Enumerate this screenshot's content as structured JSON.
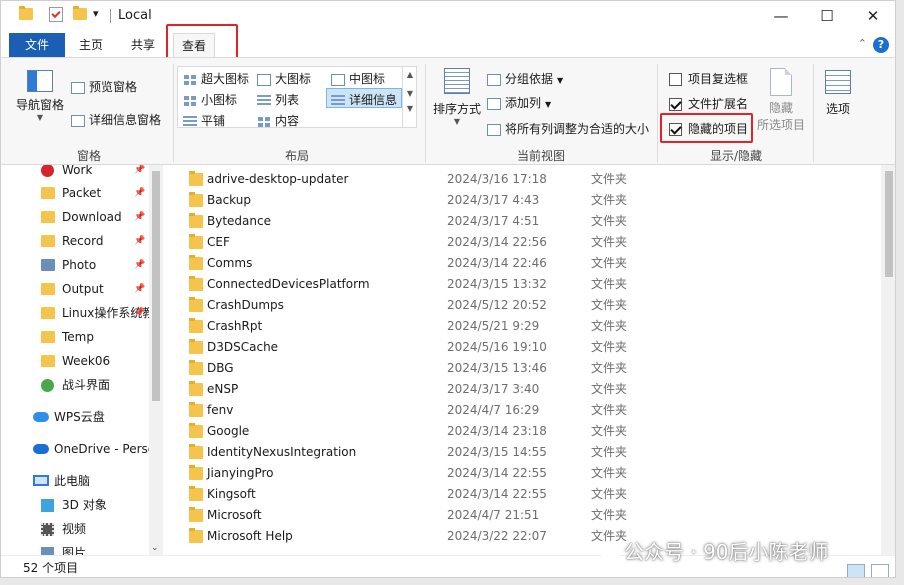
{
  "window": {
    "title": "Local"
  },
  "titlebar": {
    "dropdown_glyph": "▾",
    "minimize": "—",
    "maximize": "☐",
    "close": "✕"
  },
  "tabs": {
    "file": "文件",
    "home": "主页",
    "share": "共享",
    "view": "查看",
    "help": "?",
    "collapse": "⌃"
  },
  "ribbon": {
    "panes": {
      "label": "窗格",
      "nav_pane": "导航窗格",
      "preview": "预览窗格",
      "details": "详细信息窗格"
    },
    "layout": {
      "label": "布局",
      "xlarge": "超大图标",
      "large": "大图标",
      "medium": "中图标",
      "small": "小图标",
      "list": "列表",
      "detail": "详细信息",
      "tiles": "平铺",
      "content": "内容"
    },
    "current_view": {
      "label": "当前视图",
      "sort": "排序方式",
      "group": "分组依据",
      "add_column": "添加列",
      "fit_columns": "将所有列调整为合适的大小"
    },
    "show_hide": {
      "label": "显示/隐藏",
      "checkboxes": "项目复选框",
      "extensions": "文件扩展名",
      "hidden": "隐藏的项目",
      "hide_selected_line1": "隐藏",
      "hide_selected_line2": "所选项目"
    },
    "options": {
      "label": "选项"
    }
  },
  "nav": {
    "items": [
      {
        "label": "Work",
        "pinned": true
      },
      {
        "label": "Packet",
        "pinned": true
      },
      {
        "label": "Download",
        "pinned": true
      },
      {
        "label": "Record",
        "pinned": true
      },
      {
        "label": "Photo",
        "pinned": true
      },
      {
        "label": "Output",
        "pinned": true
      },
      {
        "label": "Linux操作系统教",
        "pinned": true
      },
      {
        "label": "Temp",
        "pinned": false
      },
      {
        "label": "Week06",
        "pinned": false
      },
      {
        "label": "战斗界面",
        "pinned": false
      },
      {
        "label": "WPS云盘",
        "pinned": false
      },
      {
        "label": "OneDrive - Perso",
        "pinned": false
      },
      {
        "label": "此电脑",
        "pinned": false
      },
      {
        "label": "3D 对象",
        "pinned": false
      },
      {
        "label": "视频",
        "pinned": false
      },
      {
        "label": "图片",
        "pinned": false
      }
    ]
  },
  "files": {
    "rows": [
      {
        "name": "adrive-desktop-updater",
        "date": "2024/3/16 17:18",
        "type": "文件夹"
      },
      {
        "name": "Backup",
        "date": "2024/3/17 4:43",
        "type": "文件夹"
      },
      {
        "name": "Bytedance",
        "date": "2024/3/17 4:51",
        "type": "文件夹"
      },
      {
        "name": "CEF",
        "date": "2024/3/14 22:56",
        "type": "文件夹"
      },
      {
        "name": "Comms",
        "date": "2024/3/14 22:46",
        "type": "文件夹"
      },
      {
        "name": "ConnectedDevicesPlatform",
        "date": "2024/3/15 13:32",
        "type": "文件夹"
      },
      {
        "name": "CrashDumps",
        "date": "2024/5/12 20:52",
        "type": "文件夹"
      },
      {
        "name": "CrashRpt",
        "date": "2024/5/21 9:29",
        "type": "文件夹"
      },
      {
        "name": "D3DSCache",
        "date": "2024/5/16 19:10",
        "type": "文件夹"
      },
      {
        "name": "DBG",
        "date": "2024/3/15 13:46",
        "type": "文件夹"
      },
      {
        "name": "eNSP",
        "date": "2024/3/17 3:40",
        "type": "文件夹"
      },
      {
        "name": "fenv",
        "date": "2024/4/7 16:29",
        "type": "文件夹"
      },
      {
        "name": "Google",
        "date": "2024/3/14 23:18",
        "type": "文件夹"
      },
      {
        "name": "IdentityNexusIntegration",
        "date": "2024/3/15 14:55",
        "type": "文件夹"
      },
      {
        "name": "JianyingPro",
        "date": "2024/3/14 22:55",
        "type": "文件夹"
      },
      {
        "name": "Kingsoft",
        "date": "2024/3/14 22:55",
        "type": "文件夹"
      },
      {
        "name": "Microsoft",
        "date": "2024/4/7 21:51",
        "type": "文件夹"
      },
      {
        "name": "Microsoft Help",
        "date": "2024/3/22 22:07",
        "type": "文件夹"
      }
    ]
  },
  "status": {
    "count": "52 个项目"
  },
  "watermark": {
    "text": "公众号 · 90后小陈老师"
  },
  "colors": {
    "accent": "#1a5fb4",
    "highlight_box": "#e0242a",
    "folder": "#f5c44c"
  }
}
